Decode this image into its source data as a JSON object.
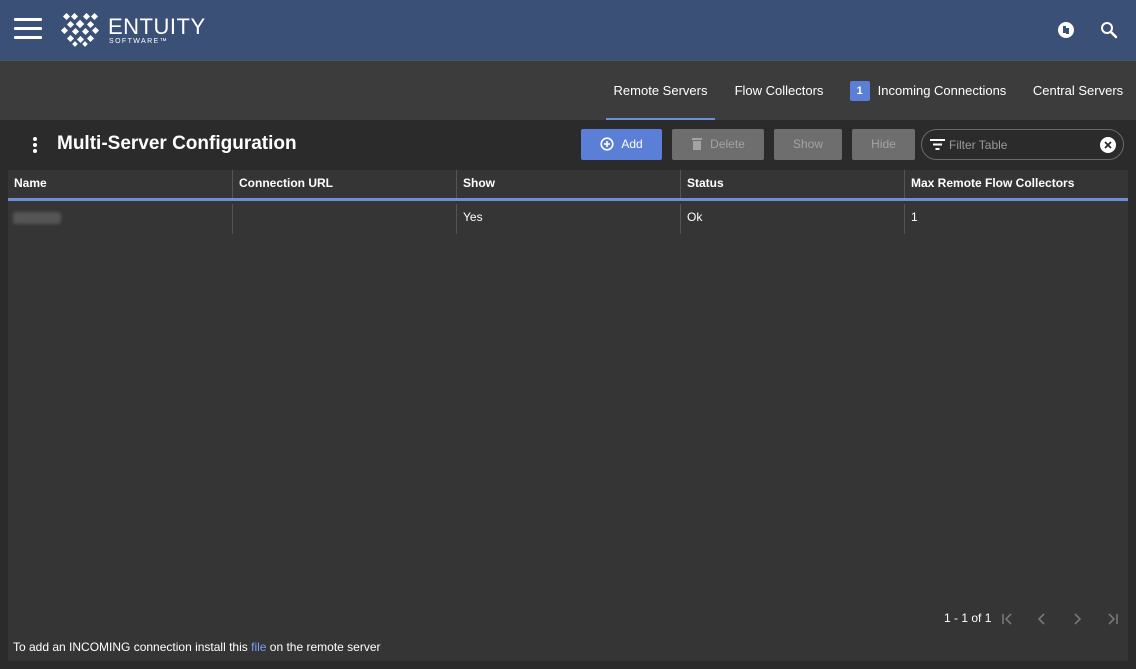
{
  "app": {
    "brand": "ENTUITY",
    "brand_sub": "SOFTWARE™",
    "icons": {
      "menu": "hamburger-menu-icon",
      "unknown": "info-badge-icon",
      "search": "search-icon"
    }
  },
  "tabs": [
    {
      "label": "Remote Servers",
      "active": true
    },
    {
      "label": "Flow Collectors",
      "active": false
    },
    {
      "label": "Incoming Connections",
      "badge": "1",
      "active": false
    },
    {
      "label": "Central Servers",
      "active": false
    }
  ],
  "page": {
    "title": "Multi-Server Configuration",
    "toolbar": {
      "add": "Add",
      "delete": "Delete",
      "show": "Show",
      "hide": "Hide"
    },
    "filter": {
      "placeholder": "Filter Table",
      "value": ""
    }
  },
  "table": {
    "columns": [
      "Name",
      "Connection URL",
      "Show",
      "Status",
      "Max Remote Flow Collectors"
    ],
    "rows": [
      {
        "name": "",
        "connection_url": "",
        "show": "Yes",
        "status": "Ok",
        "max_remote_flow_collectors": "1"
      }
    ]
  },
  "pager": {
    "text": "1 - 1 of 1"
  },
  "footer": {
    "before": "To add an INCOMING connection install this ",
    "link": "file",
    "after": " on the remote server"
  },
  "colors": {
    "accent": "#5b7ed6",
    "topbar": "#3a5077",
    "link": "#7c9ff0"
  }
}
